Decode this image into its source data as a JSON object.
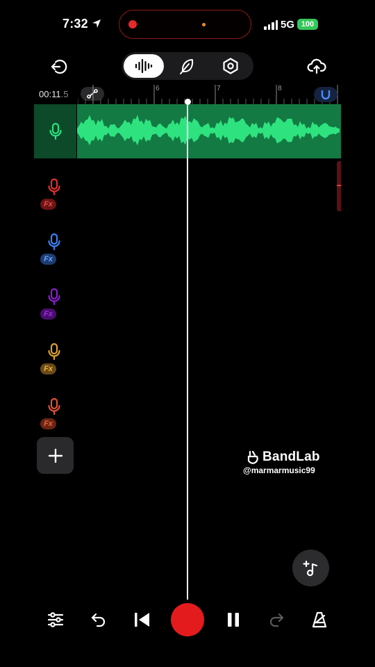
{
  "status_bar": {
    "time": "7:32",
    "network": "5G",
    "battery": "100"
  },
  "toolbar": {
    "exit_icon": "exit-icon",
    "tabs": [
      {
        "name": "tracks",
        "icon": "waveform-icon",
        "active": true
      },
      {
        "name": "effects",
        "icon": "feather-icon",
        "active": false
      },
      {
        "name": "settings",
        "icon": "hexagon-settings-icon",
        "active": false
      }
    ],
    "upload_icon": "cloud-upload-icon"
  },
  "timeline": {
    "time_main": "00:11",
    "time_fraction": ".5",
    "ruler_labels": [
      "6",
      "7",
      "8"
    ]
  },
  "tracks": [
    {
      "type": "voice",
      "color": "#2ecc71",
      "active": true
    },
    {
      "type": "voice",
      "color": "#e03131",
      "fx": "Fx"
    },
    {
      "type": "voice",
      "color": "#3b82f6",
      "fx": "Fx"
    },
    {
      "type": "voice",
      "color": "#8b1fd1",
      "fx": "Fx"
    },
    {
      "type": "voice",
      "color": "#e0a030",
      "fx": "Fx"
    },
    {
      "type": "voice",
      "color": "#e0533a",
      "fx": "Fx"
    }
  ],
  "colors": {
    "accent_green": "#2ee37f",
    "region_green": "#137a43",
    "record_red": "#e41b1d"
  },
  "watermark": {
    "brand": "BandLab",
    "handle": "@marmarmusic99"
  },
  "transport": {
    "mixer_icon": "mixer-sliders-icon",
    "undo_icon": "undo-icon",
    "skip_back_icon": "skip-to-start-icon",
    "record_icon": "record-icon",
    "pause_icon": "pause-icon",
    "redo_icon": "redo-icon",
    "metronome_icon": "metronome-icon"
  }
}
